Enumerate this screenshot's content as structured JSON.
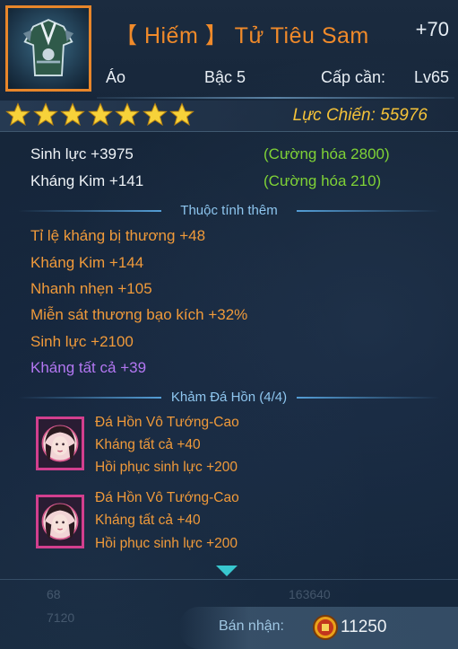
{
  "item": {
    "name": "【 Hiếm 】 Tử Tiêu Sam",
    "enhance": "+70",
    "type": "Áo",
    "tier": "Bậc 5",
    "req_label": "Cấp cần:",
    "req_level": "Lv65",
    "stars": 7,
    "power_label": "Lực Chiến:",
    "power_value": "55976"
  },
  "base_stats": [
    {
      "name": "Sinh lực",
      "value": "+3975",
      "bonus": "(Cường hóa 2800)"
    },
    {
      "name": "Kháng Kim",
      "value": "+141",
      "bonus": "(Cường hóa 210)"
    }
  ],
  "extra_title": "Thuộc tính thêm",
  "extra_stats": [
    {
      "name": "Tỉ lệ kháng bị thương",
      "value": "+48"
    },
    {
      "name": "Kháng Kim",
      "value": "+144"
    },
    {
      "name": "Nhanh nhẹn",
      "value": "+105"
    },
    {
      "name": "Miễn sát thương bạo kích",
      "value": "+32%"
    },
    {
      "name": "Sinh lực",
      "value": "+2100"
    },
    {
      "name": "Kháng tất cả",
      "value": "+39"
    }
  ],
  "gem_title": "Khảm Đá Hồn (4/4)",
  "gems": [
    {
      "name": "Đá Hồn Vô Tướng-Cao",
      "line1_name": "Kháng tất cả",
      "line1_value": "+40",
      "line2_name": "Hồi phục sinh lực",
      "line2_value": "+200"
    },
    {
      "name": "Đá Hồn Vô Tướng-Cao",
      "line1_name": "Kháng tất cả",
      "line1_value": "+40",
      "line2_name": "Hồi phục sinh lực",
      "line2_value": "+200"
    }
  ],
  "faded": {
    "row1_a": "68",
    "row1_b": "163640",
    "row2_a": "7120"
  },
  "footer": {
    "sell_label": "Bán nhận:",
    "sell_price": "11250"
  },
  "colors": {
    "rare_orange": "#f08a2a",
    "power_gold": "#f4c239",
    "green": "#7fd236",
    "purple": "#b377f2",
    "gem_border": "#d23f8e",
    "arrow_teal": "#38c7cf"
  }
}
